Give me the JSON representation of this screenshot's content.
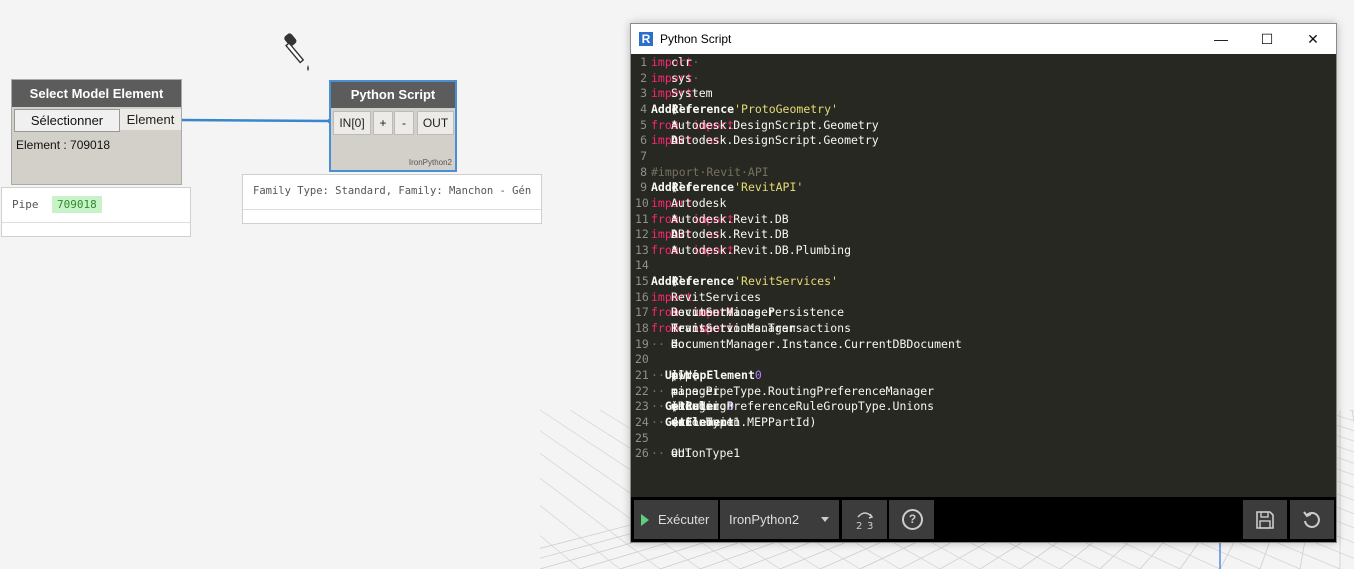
{
  "canvas": {
    "node_select": {
      "title": "Select Model Element",
      "button_label": "Sélectionner",
      "output_port": "Element",
      "info": "Element : 709018",
      "preview_label": "Pipe",
      "preview_value": "709018"
    },
    "node_python": {
      "title": "Python Script",
      "input_port": "IN[0]",
      "add_label": "+",
      "remove_label": "-",
      "output_port": "OUT",
      "engine_tag": "IronPython2",
      "preview_text": "Family Type: Standard, Family: Manchon - Gén"
    }
  },
  "window": {
    "title": "Python Script",
    "app_icon_letter": "R",
    "minimize": "—",
    "maximize": "☐",
    "close": "✕"
  },
  "toolbar": {
    "run_label": "Exécuter",
    "engine_label": "IronPython2",
    "migrate_label": "2→3",
    "help_label": "?",
    "save_icon": "save-icon",
    "revert_icon": "revert-icon"
  },
  "code": [
    {
      "n": "1",
      "segs": [
        [
          "kw",
          "import"
        ],
        [
          "dot",
          "·"
        ],
        [
          "tx",
          "clr"
        ]
      ]
    },
    {
      "n": "2",
      "segs": [
        [
          "kw",
          "import"
        ],
        [
          "dot",
          "·"
        ],
        [
          "tx",
          "sys"
        ]
      ]
    },
    {
      "n": "3",
      "segs": [
        [
          "kw",
          "import"
        ],
        [
          "dot",
          "·"
        ],
        [
          "tx",
          "System"
        ]
      ]
    },
    {
      "n": "4",
      "segs": [
        [
          "tx",
          "clr."
        ],
        [
          "fn",
          "AddReference"
        ],
        [
          "tx",
          "("
        ],
        [
          "str",
          "'ProtoGeometry'"
        ],
        [
          "tx",
          ")"
        ]
      ]
    },
    {
      "n": "5",
      "segs": [
        [
          "kw",
          "from"
        ],
        [
          "dot",
          "·"
        ],
        [
          "tx",
          "Autodesk.DesignScript.Geometry"
        ],
        [
          "dot",
          "·"
        ],
        [
          "kw",
          "import"
        ],
        [
          "dot",
          "·"
        ],
        [
          "tx",
          "*"
        ]
      ]
    },
    {
      "n": "6",
      "segs": [
        [
          "kw",
          "import"
        ],
        [
          "dot",
          "·"
        ],
        [
          "tx",
          "Autodesk.DesignScript.Geometry"
        ],
        [
          "dot",
          "·"
        ],
        [
          "kw",
          "as"
        ],
        [
          "dot",
          "·"
        ],
        [
          "tx",
          "DS"
        ]
      ]
    },
    {
      "n": "7",
      "segs": []
    },
    {
      "n": "8",
      "segs": [
        [
          "cm",
          "#import·Revit·API"
        ]
      ]
    },
    {
      "n": "9",
      "segs": [
        [
          "tx",
          "clr."
        ],
        [
          "fn",
          "AddReference"
        ],
        [
          "tx",
          "("
        ],
        [
          "str",
          "'RevitAPI'"
        ],
        [
          "tx",
          ")"
        ]
      ]
    },
    {
      "n": "10",
      "segs": [
        [
          "kw",
          "import"
        ],
        [
          "dot",
          "·"
        ],
        [
          "tx",
          "Autodesk"
        ]
      ]
    },
    {
      "n": "11",
      "segs": [
        [
          "kw",
          "from"
        ],
        [
          "dot",
          "·"
        ],
        [
          "tx",
          "Autodesk.Revit.DB"
        ],
        [
          "dot",
          "·"
        ],
        [
          "kw",
          "import"
        ],
        [
          "dot",
          "·"
        ],
        [
          "tx",
          "*"
        ]
      ]
    },
    {
      "n": "12",
      "segs": [
        [
          "kw",
          "import"
        ],
        [
          "dot",
          "·"
        ],
        [
          "tx",
          "Autodesk.Revit.DB"
        ],
        [
          "dot",
          "·"
        ],
        [
          "kw",
          "as"
        ],
        [
          "dot",
          "·"
        ],
        [
          "tx",
          "DB"
        ]
      ]
    },
    {
      "n": "13",
      "segs": [
        [
          "kw",
          "from"
        ],
        [
          "dot",
          "·"
        ],
        [
          "tx",
          "Autodesk.Revit.DB.Plumbing"
        ],
        [
          "dot",
          "·"
        ],
        [
          "kw",
          "import"
        ],
        [
          "dot",
          "·"
        ],
        [
          "tx",
          "*"
        ]
      ]
    },
    {
      "n": "14",
      "segs": []
    },
    {
      "n": "15",
      "segs": [
        [
          "tx",
          "clr."
        ],
        [
          "fn",
          "AddReference"
        ],
        [
          "tx",
          "("
        ],
        [
          "str",
          "'RevitServices'"
        ],
        [
          "tx",
          ")"
        ]
      ]
    },
    {
      "n": "16",
      "segs": [
        [
          "kw",
          "import"
        ],
        [
          "dot",
          "·"
        ],
        [
          "tx",
          "RevitServices"
        ]
      ]
    },
    {
      "n": "17",
      "segs": [
        [
          "kw",
          "from"
        ],
        [
          "dot",
          "·"
        ],
        [
          "tx",
          "RevitServices.Persistence"
        ],
        [
          "dot",
          "·"
        ],
        [
          "kw",
          "import"
        ],
        [
          "dot",
          "·"
        ],
        [
          "tx",
          "DocumentManager"
        ]
      ]
    },
    {
      "n": "18",
      "segs": [
        [
          "kw",
          "from"
        ],
        [
          "dot",
          "·"
        ],
        [
          "tx",
          "RevitServices.Transactions"
        ],
        [
          "dot",
          "·"
        ],
        [
          "kw",
          "import"
        ],
        [
          "dot",
          "·"
        ],
        [
          "tx",
          "TransactionManager"
        ]
      ]
    },
    {
      "n": "19",
      "segs": [
        [
          "tx",
          "doc"
        ],
        [
          "dot",
          "·"
        ],
        [
          "tx",
          "="
        ],
        [
          "dot",
          "·"
        ],
        [
          "tx",
          "DocumentManager.Instance.CurrentDBDocument"
        ]
      ]
    },
    {
      "n": "20",
      "segs": []
    },
    {
      "n": "21",
      "segs": [
        [
          "tx",
          "pipe"
        ],
        [
          "dot",
          "·"
        ],
        [
          "tx",
          "="
        ],
        [
          "dot",
          "·"
        ],
        [
          "fn",
          "UnwrapElement"
        ],
        [
          "tx",
          "(IN["
        ],
        [
          "num",
          "0"
        ],
        [
          "tx",
          "])"
        ]
      ]
    },
    {
      "n": "22",
      "segs": [
        [
          "tx",
          "manager"
        ],
        [
          "dot",
          "·"
        ],
        [
          "tx",
          "="
        ],
        [
          "dot",
          "·"
        ],
        [
          "tx",
          "pipe.PipeType.RoutingPreferenceManager"
        ]
      ]
    },
    {
      "n": "23",
      "segs": [
        [
          "tx",
          "ruleUnion"
        ],
        [
          "dot",
          "·"
        ],
        [
          "tx",
          "="
        ],
        [
          "dot",
          "·"
        ],
        [
          "tx",
          "manager."
        ],
        [
          "fn",
          "GetRule"
        ],
        [
          "tx",
          "(RoutingPreferenceRuleGroupType.Unions"
        ],
        [
          "dot",
          "·"
        ],
        [
          "tx",
          ","
        ],
        [
          "dot",
          "·"
        ],
        [
          "num",
          "0"
        ],
        [
          "tx",
          ")"
        ]
      ]
    },
    {
      "n": "24",
      "segs": [
        [
          "tx",
          "unionType1"
        ],
        [
          "dot",
          "·"
        ],
        [
          "tx",
          "="
        ],
        [
          "dot",
          "·"
        ],
        [
          "tx",
          "doc."
        ],
        [
          "fn",
          "GetElement"
        ],
        [
          "tx",
          "(ruleUnion.MEPPartId)"
        ]
      ]
    },
    {
      "n": "25",
      "segs": []
    },
    {
      "n": "26",
      "segs": [
        [
          "tx",
          "OUT"
        ],
        [
          "dot",
          "·"
        ],
        [
          "tx",
          "="
        ],
        [
          "dot",
          "·"
        ],
        [
          "tx",
          "unionType1"
        ]
      ]
    }
  ]
}
